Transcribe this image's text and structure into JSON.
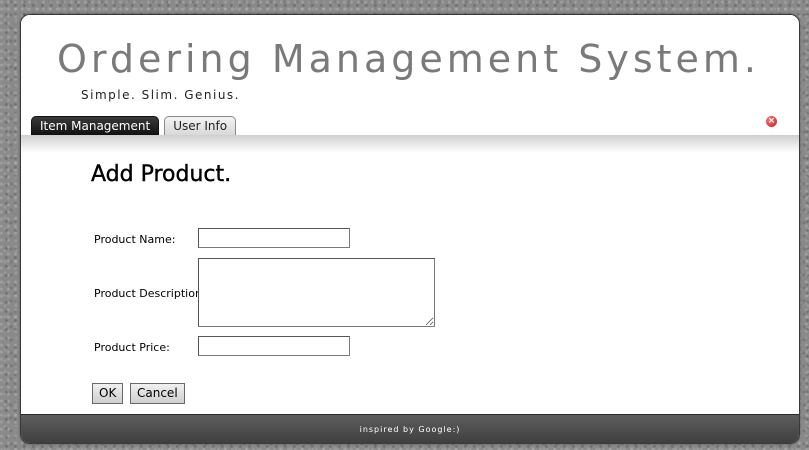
{
  "header": {
    "title": "Ordering Management System.",
    "tagline": "Simple. Slim. Genius."
  },
  "tabs": [
    {
      "label": "Item Management",
      "active": true
    },
    {
      "label": "User Info",
      "active": false
    }
  ],
  "close_icon": "close-icon",
  "main": {
    "title": "Add Product.",
    "fields": {
      "name": {
        "label": "Product Name:",
        "value": ""
      },
      "description": {
        "label": "Product Description:",
        "value": ""
      },
      "price": {
        "label": "Product Price:",
        "value": ""
      }
    },
    "buttons": {
      "ok": "OK",
      "cancel": "Cancel"
    }
  },
  "footer": {
    "text": "inspired by Google:)"
  },
  "colors": {
    "active_tab": "#1a1a1a",
    "footer": "#4a4a4a",
    "close_icon": "#d42a2a"
  }
}
